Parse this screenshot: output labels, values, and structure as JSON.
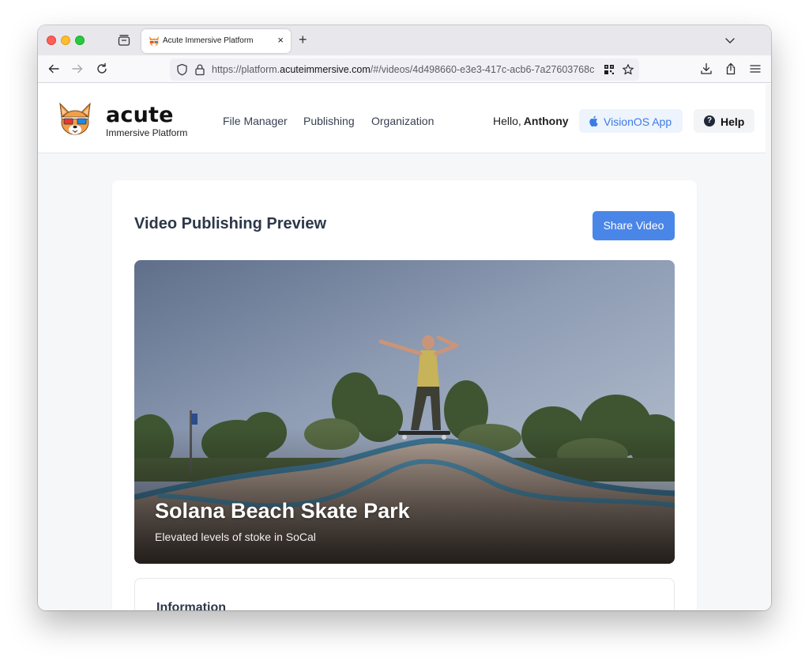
{
  "browser": {
    "tab_title": "Acute Immersive Platform",
    "tab_close": "×",
    "new_tab": "+",
    "url_prefix": "https://platform.",
    "url_domain": "acuteimmersive.com",
    "url_path": "/#/videos/4d498660-e3e3-417c-acb6-7a27603768c"
  },
  "header": {
    "brand": "acute",
    "brand_sub": "Immersive Platform",
    "nav": [
      "File Manager",
      "Publishing",
      "Organization"
    ],
    "hello": "Hello,",
    "user": "Anthony",
    "visionos_label": "VisionOS App",
    "help_label": "Help",
    "help_glyph": "?"
  },
  "main": {
    "title": "Video Publishing Preview",
    "share_label": "Share Video",
    "video_title": "Solana Beach Skate Park",
    "video_subtitle": "Elevated levels of stoke in SoCal",
    "info_title": "Information"
  },
  "colors": {
    "accent": "#4a86e8",
    "accent_light": "#eef4fd",
    "title": "#2d3748"
  },
  "icons": [
    "tabs-icon",
    "back-icon",
    "forward-icon",
    "reload-icon",
    "shield-icon",
    "lock-icon",
    "qr-code-icon",
    "bookmark-star-icon",
    "download-icon",
    "share-icon",
    "menu-icon",
    "apple-icon",
    "help-icon",
    "chevron-down-icon"
  ]
}
